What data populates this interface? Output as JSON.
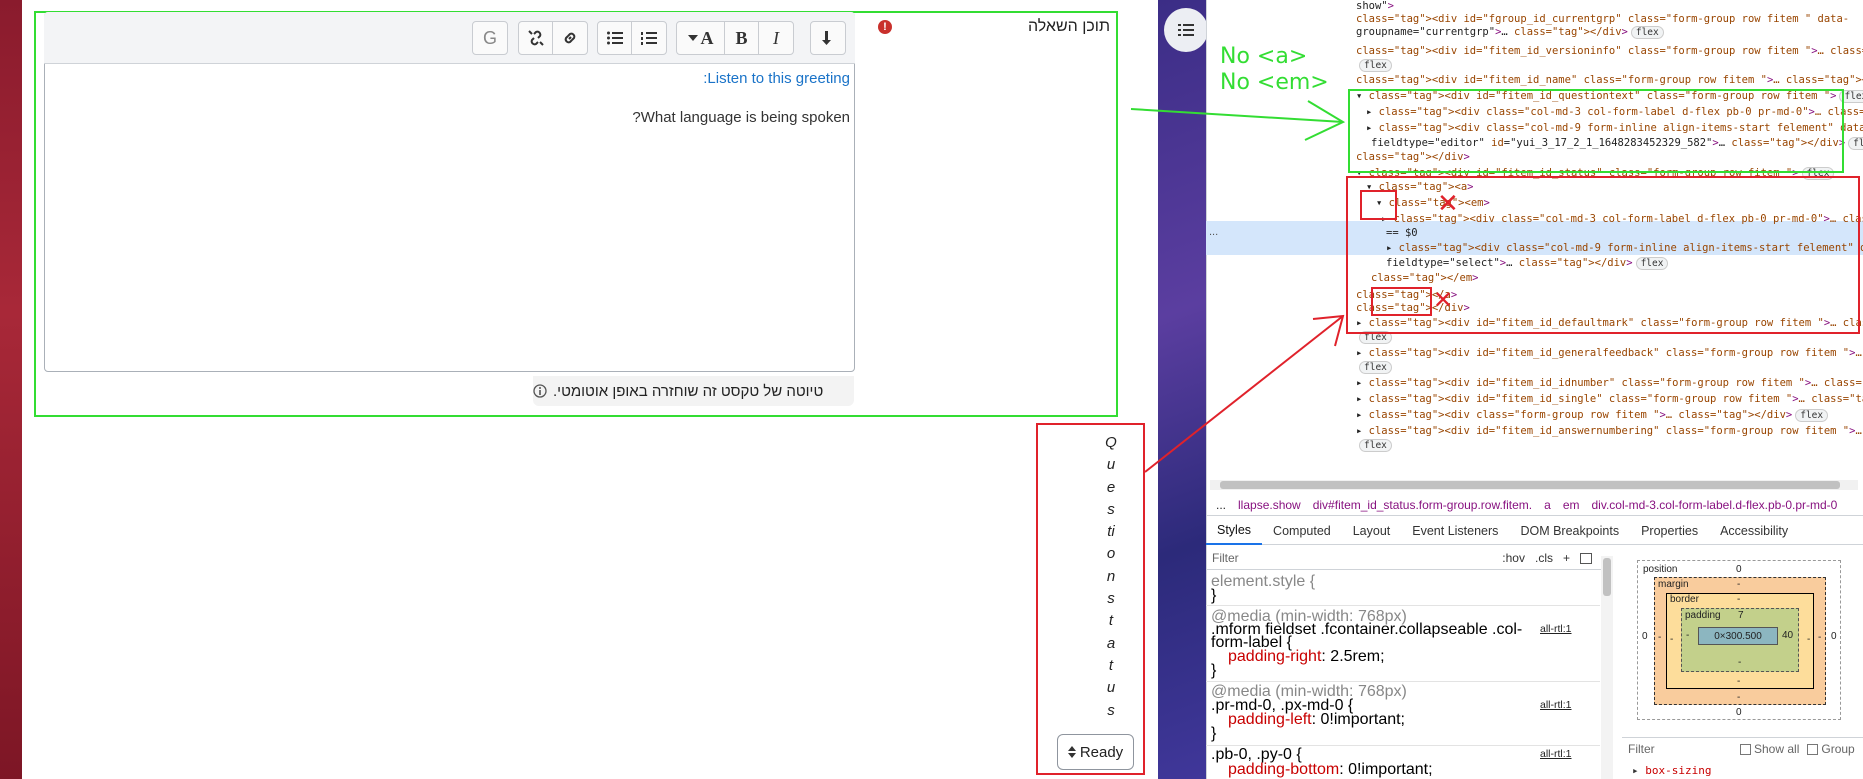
{
  "editor": {
    "toolbar": [
      "Undo/redo",
      "Font color",
      "Bold",
      "Italic",
      "Unordered list",
      "Ordered list",
      "Link",
      "Unlink",
      "Accessibility checker"
    ],
    "toolbar_icons": {
      "undo": "return-arrow-icon",
      "font_color": "font-color-icon",
      "bold": "B",
      "italic": "I",
      "bullets": "bullet-list-icon",
      "numbers": "numbered-list-icon",
      "link": "link-icon",
      "unlink": "unlink-icon",
      "g": "G"
    },
    "greeting_link": "Listen to this greeting:",
    "question_text": "What language is being spoken?",
    "draft_note": "טיוטה של טקסט זה שוחזרה באופן אוטומטי."
  },
  "form": {
    "question_label": "תוכן השאלה",
    "error_icon": "!",
    "status_label_letters": [
      "Q",
      "u",
      "e",
      "s",
      "ti",
      "o",
      "n",
      "s",
      "t",
      "a",
      "t",
      "u",
      "s"
    ],
    "status_select_value": "Ready"
  },
  "annotations": {
    "line1": "No <a>",
    "line2": "No <em>",
    "x_mark": "✕",
    "colors": {
      "green": "#33dd33",
      "red": "#e0222b"
    }
  },
  "devtools": {
    "lines": [
      {
        "t": "show\">"
      },
      {
        "t": "<div id=\"fgroup_id_currentgrp\" class=\"form-group row  fitem   \" data-"
      },
      {
        "t": "groupname=\"currentgrp\">…</div>",
        "pill": "flex"
      },
      {
        "t": "<div id=\"fitem_id_versioninfo\" class=\"form-group row  fitem   \">…</div>"
      },
      {
        "t": "",
        "pill": "flex"
      },
      {
        "t": "<div id=\"fitem_id_name\" class=\"form-group row  fitem   \">…</div>",
        "pill": "flex"
      },
      {
        "t": "▾<div id=\"fitem_id_questiontext\" class=\"form-group row  fitem   \">",
        "pill": "flex"
      },
      {
        "t": "▸<div class=\"col-md-3 col-form-label d-flex pb-0 pr-md-0\">…</div>",
        "pill": "flex"
      },
      {
        "t": "▸<div class=\"col-md-9 form-inline align-items-start felement\" data-"
      },
      {
        "t": "fieldtype=\"editor\" id=\"yui_3_17_2_1_1648283452329_582\">…</div>",
        "pill": "flex"
      },
      {
        "t": "</div>"
      },
      {
        "t": "▾<div id=\"fitem_id_status\" class=\"form-group row  fitem   \">",
        "pill": "flex"
      },
      {
        "t": "▾<a>"
      },
      {
        "t": "▾<em>"
      },
      {
        "t": "▸<div class=\"col-md-3 col-form-label d-flex pb-0 pr-md-0\">…</div>",
        "pill": "flex"
      },
      {
        "t": "== $0"
      },
      {
        "t": "▸<div class=\"col-md-9 form-inline align-items-start felement\" data-"
      },
      {
        "t": "fieldtype=\"select\">…</div>",
        "pill": "flex"
      },
      {
        "t": "</em>"
      },
      {
        "t": "</a>"
      },
      {
        "t": "</div>"
      },
      {
        "t": "▸<div id=\"fitem_id_defaultmark\" class=\"form-group row  fitem   \">…</div>"
      },
      {
        "t": "",
        "pill": "flex"
      },
      {
        "t": "▸<div id=\"fitem_id_generalfeedback\" class=\"form-group row  fitem   \">…</div>"
      },
      {
        "t": "",
        "pill": "flex"
      },
      {
        "t": "▸<div id=\"fitem_id_idnumber\" class=\"form-group row  fitem   \">…</div>",
        "pill": "flex"
      },
      {
        "t": "▸<div id=\"fitem_id_single\" class=\"form-group row  fitem   \">…</div>",
        "pill": "flex"
      },
      {
        "t": "▸<div class=\"form-group row  fitem   \">…</div>",
        "pill": "flex"
      },
      {
        "t": "▸<div id=\"fitem_id_answernumbering\" class=\"form-group row  fitem   \">…</div>"
      },
      {
        "t": "",
        "pill": "flex"
      }
    ],
    "ellipsis": "...",
    "breadcrumbs": [
      "...",
      "llapse.show",
      "div#fitem_id_status.form-group.row.fitem.",
      "a",
      "em",
      "div.col-md-3.col-form-label.d-flex.pb-0.pr-md-0"
    ],
    "tabs": [
      "Styles",
      "Computed",
      "Layout",
      "Event Listeners",
      "DOM Breakpoints",
      "Properties",
      "Accessibility"
    ],
    "filter_placeholder": "Filter",
    "filter_tools": [
      ":hov",
      ".cls",
      "+"
    ],
    "rules": [
      {
        "sel": "element.style {",
        "body": [],
        "close": "}"
      },
      {
        "media": "@media (min-width: 768px)",
        "sel": ".mform fieldset .fcontainer.collapseable .col-",
        "sel2": "form-label {",
        "src": "all-rtl:1",
        "body": [
          {
            "p": "padding-right",
            "v": "2.5rem;"
          }
        ],
        "close": "}"
      },
      {
        "media": "@media (min-width: 768px)",
        "sel": ".pr-md-0, .px-md-0 {",
        "src": "all-rtl:1",
        "body": [
          {
            "p": "padding-left",
            "v": "0!important;"
          }
        ],
        "close": "}"
      },
      {
        "sel": ".pb-0, .py-0 {",
        "src": "all-rtl:1",
        "body": [
          {
            "p": "padding-bottom",
            "v": "0!important;"
          }
        ]
      }
    ],
    "box_model": {
      "position_label": "position",
      "position": "0",
      "margin_label": "margin",
      "margin": "-",
      "border_label": "border",
      "border": "-",
      "padding_label": "padding",
      "padding_top": "7",
      "padding_left": "-",
      "padding_right": "40",
      "padding_bottom": "-",
      "content": "0×300.500",
      "outer_left": "0",
      "outer_right": "0",
      "outer_bottom": "0",
      "dash": "-"
    },
    "filter2_placeholder": "Filter",
    "show_all": "Show all",
    "group": "Group",
    "box_sizing": "box-sizing"
  }
}
